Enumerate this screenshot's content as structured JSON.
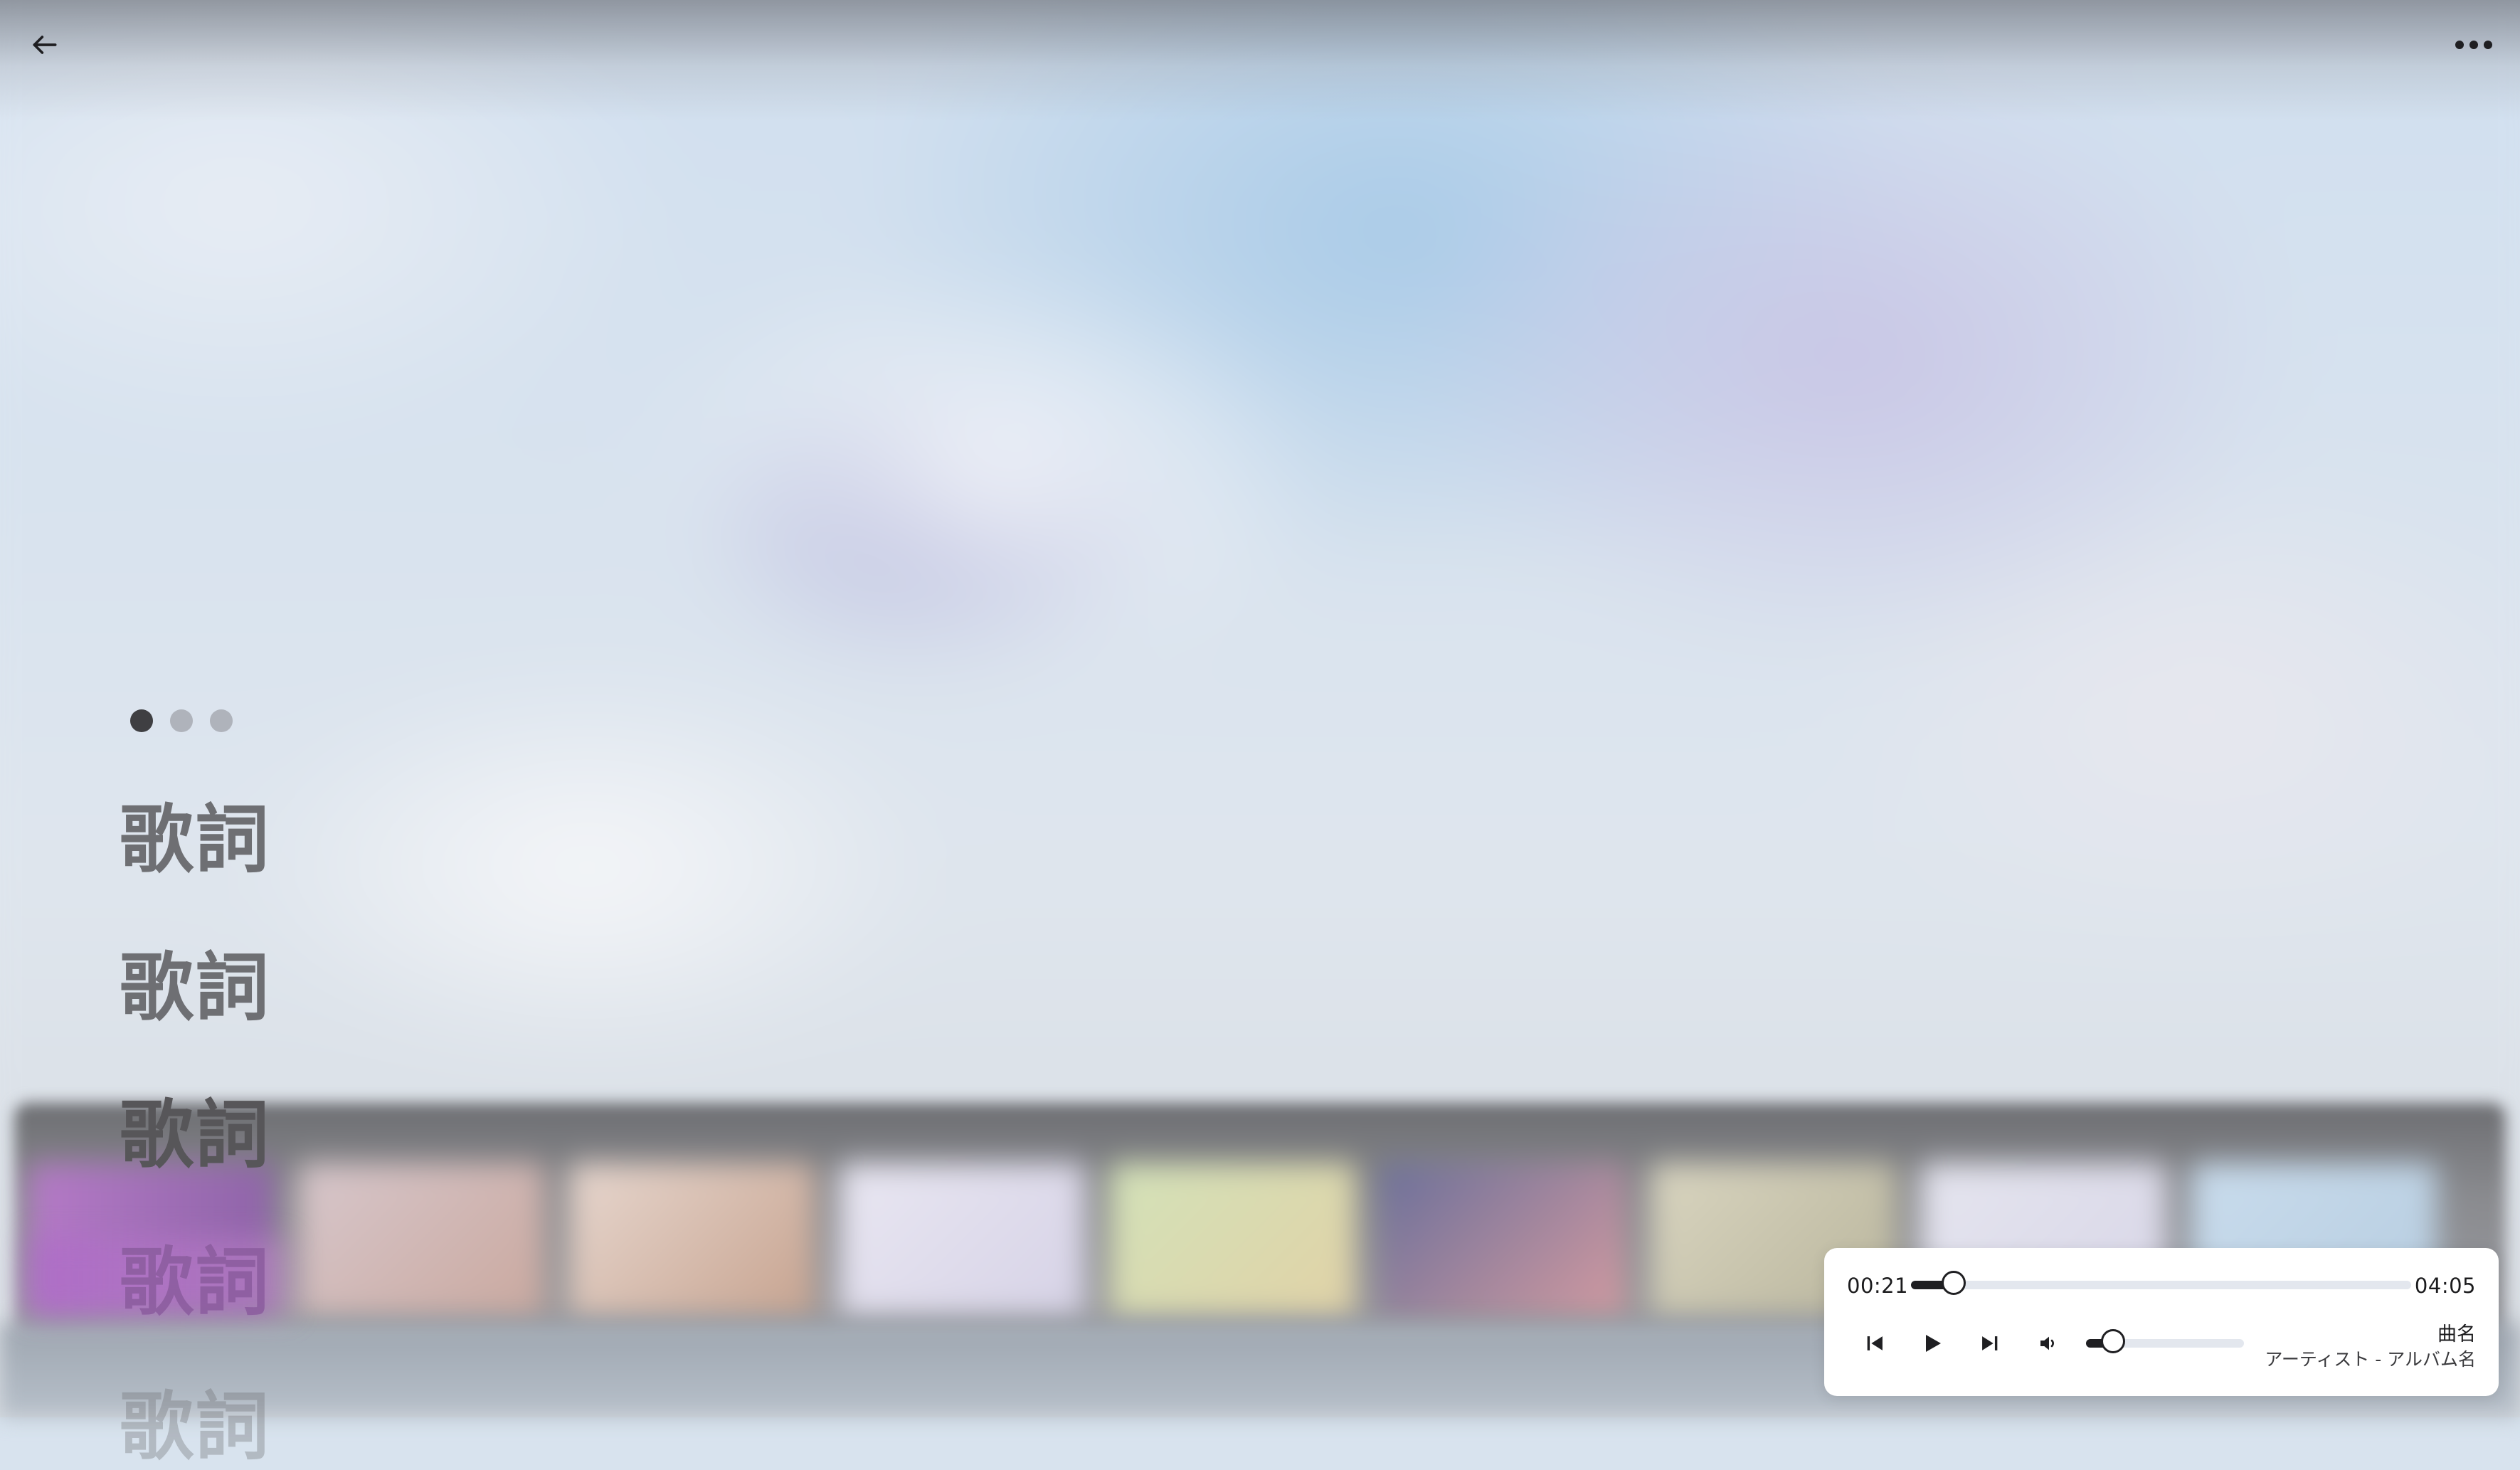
{
  "player": {
    "current_time": "00:21",
    "duration": "04:05",
    "progress": 0.086,
    "volume": 0.17,
    "song_title": "曲名",
    "artist_album": "アーティスト - アルバム名"
  },
  "lyrics": {
    "pages": 3,
    "active_page": 1,
    "lines": [
      "歌詞",
      "歌詞",
      "歌詞",
      "歌詞",
      "歌詞"
    ]
  },
  "icons": {
    "back": "arrow-left-icon",
    "more": "more-horizontal-icon",
    "previous": "skip-previous-icon",
    "play": "play-icon",
    "next": "skip-next-icon",
    "volume": "volume-icon"
  },
  "colors": {
    "accent": "#1f1f22",
    "track": "#e3e7ee",
    "card": "#ffffff",
    "lyric": "#6e6f73"
  }
}
